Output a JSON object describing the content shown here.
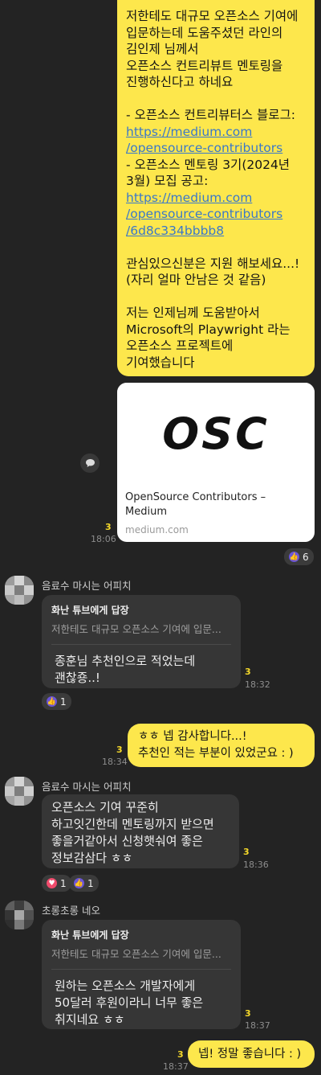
{
  "messages": {
    "m1": {
      "lines": [
        "저한테도 대규모 오픈소스 기여에",
        "입문하는데 도움주셨던 라인의",
        "김인제 님께서",
        "오픈소스 컨트리뷰트 멘토링을",
        "진행하신다고 하네요",
        "",
        "- 오픈소스 컨트리뷰터스 블로그:"
      ],
      "link1": [
        "https://medium.com",
        "/opensource-contributors"
      ],
      "line_after_link1": [
        "- 오픈소스 멘토링 3기(2024년",
        "3월) 모집 공고:"
      ],
      "link2": [
        "https://medium.com",
        "/opensource-contributors",
        "/6d8c334bbbb8"
      ],
      "lines_tail": [
        "관심있으신분은 지원 해보세요...!",
        "(자리 얼마 안남은 것 같음)",
        "",
        "저는 인제님께 도움받아서",
        "Microsoft의 Playwright 라는",
        "오픈소스 프로젝트에",
        "기여했습니다"
      ]
    },
    "preview": {
      "logo": "OSC",
      "title_line1": "OpenSource Contributors –",
      "title_line2": "Medium",
      "domain": "medium.com"
    },
    "m1_meta": {
      "unread": "3",
      "time": "18:06",
      "reaction_count": "6"
    },
    "m2": {
      "sender": "음료수 마시는 어피치",
      "reply_to": "화난 튜브에게 답장",
      "quote": "저한테도 대규모 오픈소스 기여에 입문...",
      "lines": [
        "종훈님 추천인으로 적었는데",
        "괜찮죵..!"
      ],
      "unread": "3",
      "time": "18:32",
      "reaction_count": "1"
    },
    "m3": {
      "lines": [
        "ㅎㅎ 넵 감사합니다...!",
        "추천인 적는 부분이 있었군요 : )"
      ],
      "unread": "3",
      "time": "18:34"
    },
    "m4": {
      "sender": "음료수 마시는 어피치",
      "lines": [
        "오픈소스 기여 꾸준히",
        "하고잇긴한데 멘토링까지 받으면",
        "좋을거같아서 신청햇숴여 좋은",
        "정보감삼다 ㅎㅎ"
      ],
      "unread": "3",
      "time": "18:36",
      "heart_count": "1",
      "like_count": "1"
    },
    "m5": {
      "sender": "초롱초롱 네오",
      "reply_to": "화난 튜브에게 답장",
      "quote": "저한테도 대규모 오픈소스 기여에 입문...",
      "lines": [
        "원하는 오픈소스 개발자에게",
        "50달러 후원이라니 너무 좋은",
        "취지네요 ㅎㅎ"
      ],
      "unread": "3",
      "time": "18:37"
    },
    "m6": {
      "text": "넵! 정말 좋습니다 : )",
      "unread": "3",
      "time": "18:37"
    }
  },
  "colors": {
    "my_bubble": "#fde74c",
    "other_bubble": "#363636",
    "background": "#232323",
    "link": "#3a78c9",
    "unread": "#f5d92a"
  }
}
